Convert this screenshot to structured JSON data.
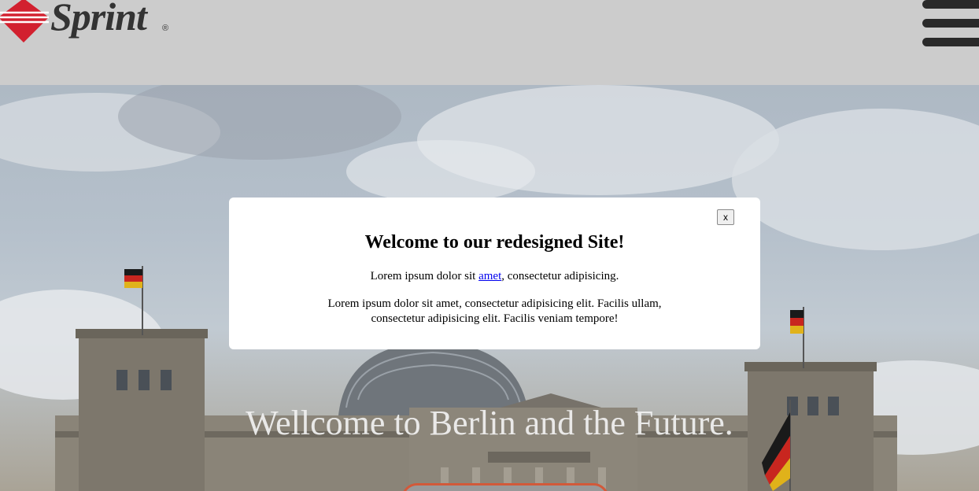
{
  "header": {
    "logo_text": "Sprint",
    "logo_registered": "®",
    "menu_icon": "hamburger-menu-icon"
  },
  "hero": {
    "title": "Wellcome to Berlin and the Future.",
    "image_icon": "reichstag-building-photo"
  },
  "modal": {
    "close_label": "x",
    "title": "Welcome to our redesigned Site!",
    "p1_before": "Lorem ipsum dolor sit ",
    "p1_link": "amet",
    "p1_after": ", consectetur adipisicing.",
    "p2": "Lorem ipsum dolor sit amet, consectetur adipisicing elit. Facilis ullam, consectetur adipisicing elit. Facilis veniam tempore!"
  },
  "colors": {
    "header_bg": "#cccccc",
    "logo_red": "#d2202f",
    "link": "#0000ee",
    "button_border": "#d2593a"
  }
}
